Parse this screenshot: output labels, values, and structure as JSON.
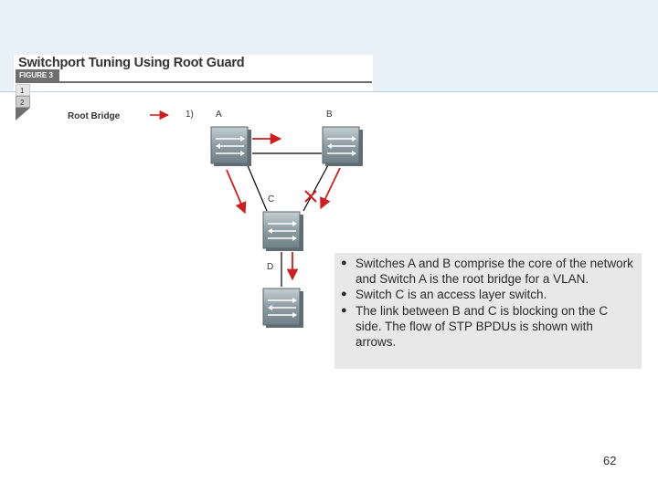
{
  "figure": {
    "title": "Switchport Tuning Using Root Guard",
    "tab_label": "FIGURE 3",
    "step_tabs": [
      "1",
      "2"
    ]
  },
  "diagram": {
    "root_bridge_label": "Root Bridge",
    "step_label": "1)",
    "switches": [
      {
        "id": "A",
        "label": "A"
      },
      {
        "id": "B",
        "label": "B"
      },
      {
        "id": "C",
        "label": "C"
      },
      {
        "id": "D",
        "label": "D"
      }
    ],
    "blocked_link": "B-C",
    "arrow_color": "#cc1f1f",
    "link_color": "#000000",
    "switch_color": "#8a9aa0"
  },
  "notes": [
    "Switches A and B comprise the core of the network and Switch A is the root bridge for a VLAN.",
    "Switch C is an access layer switch.",
    "The link between B and C is blocking on the C side. The flow of STP BPDUs is shown with arrows."
  ],
  "page_number": "62"
}
